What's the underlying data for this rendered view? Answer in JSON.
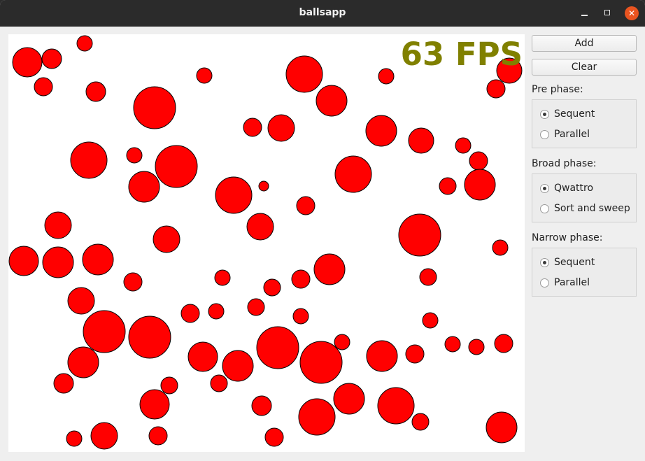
{
  "window": {
    "title": "ballsapp",
    "minimize_icon": "minimize-icon",
    "maximize_icon": "maximize-icon",
    "close_icon": "close-icon",
    "close_glyph": "✕"
  },
  "canvas": {
    "fps_text": "63 FPS",
    "fps_color": "#808000",
    "ball_color": "#ff0000",
    "ball_stroke": "#000000"
  },
  "controls": {
    "add_label": "Add",
    "clear_label": "Clear",
    "groups": [
      {
        "label": "Pre phase:",
        "options": [
          {
            "label": "Sequent",
            "checked": true
          },
          {
            "label": "Parallel",
            "checked": false
          }
        ]
      },
      {
        "label": "Broad phase:",
        "options": [
          {
            "label": "Qwattro",
            "checked": true
          },
          {
            "label": "Sort and sweep",
            "checked": false
          }
        ]
      },
      {
        "label": "Narrow phase:",
        "options": [
          {
            "label": "Sequent",
            "checked": true
          },
          {
            "label": "Parallel",
            "checked": false
          }
        ]
      }
    ]
  }
}
